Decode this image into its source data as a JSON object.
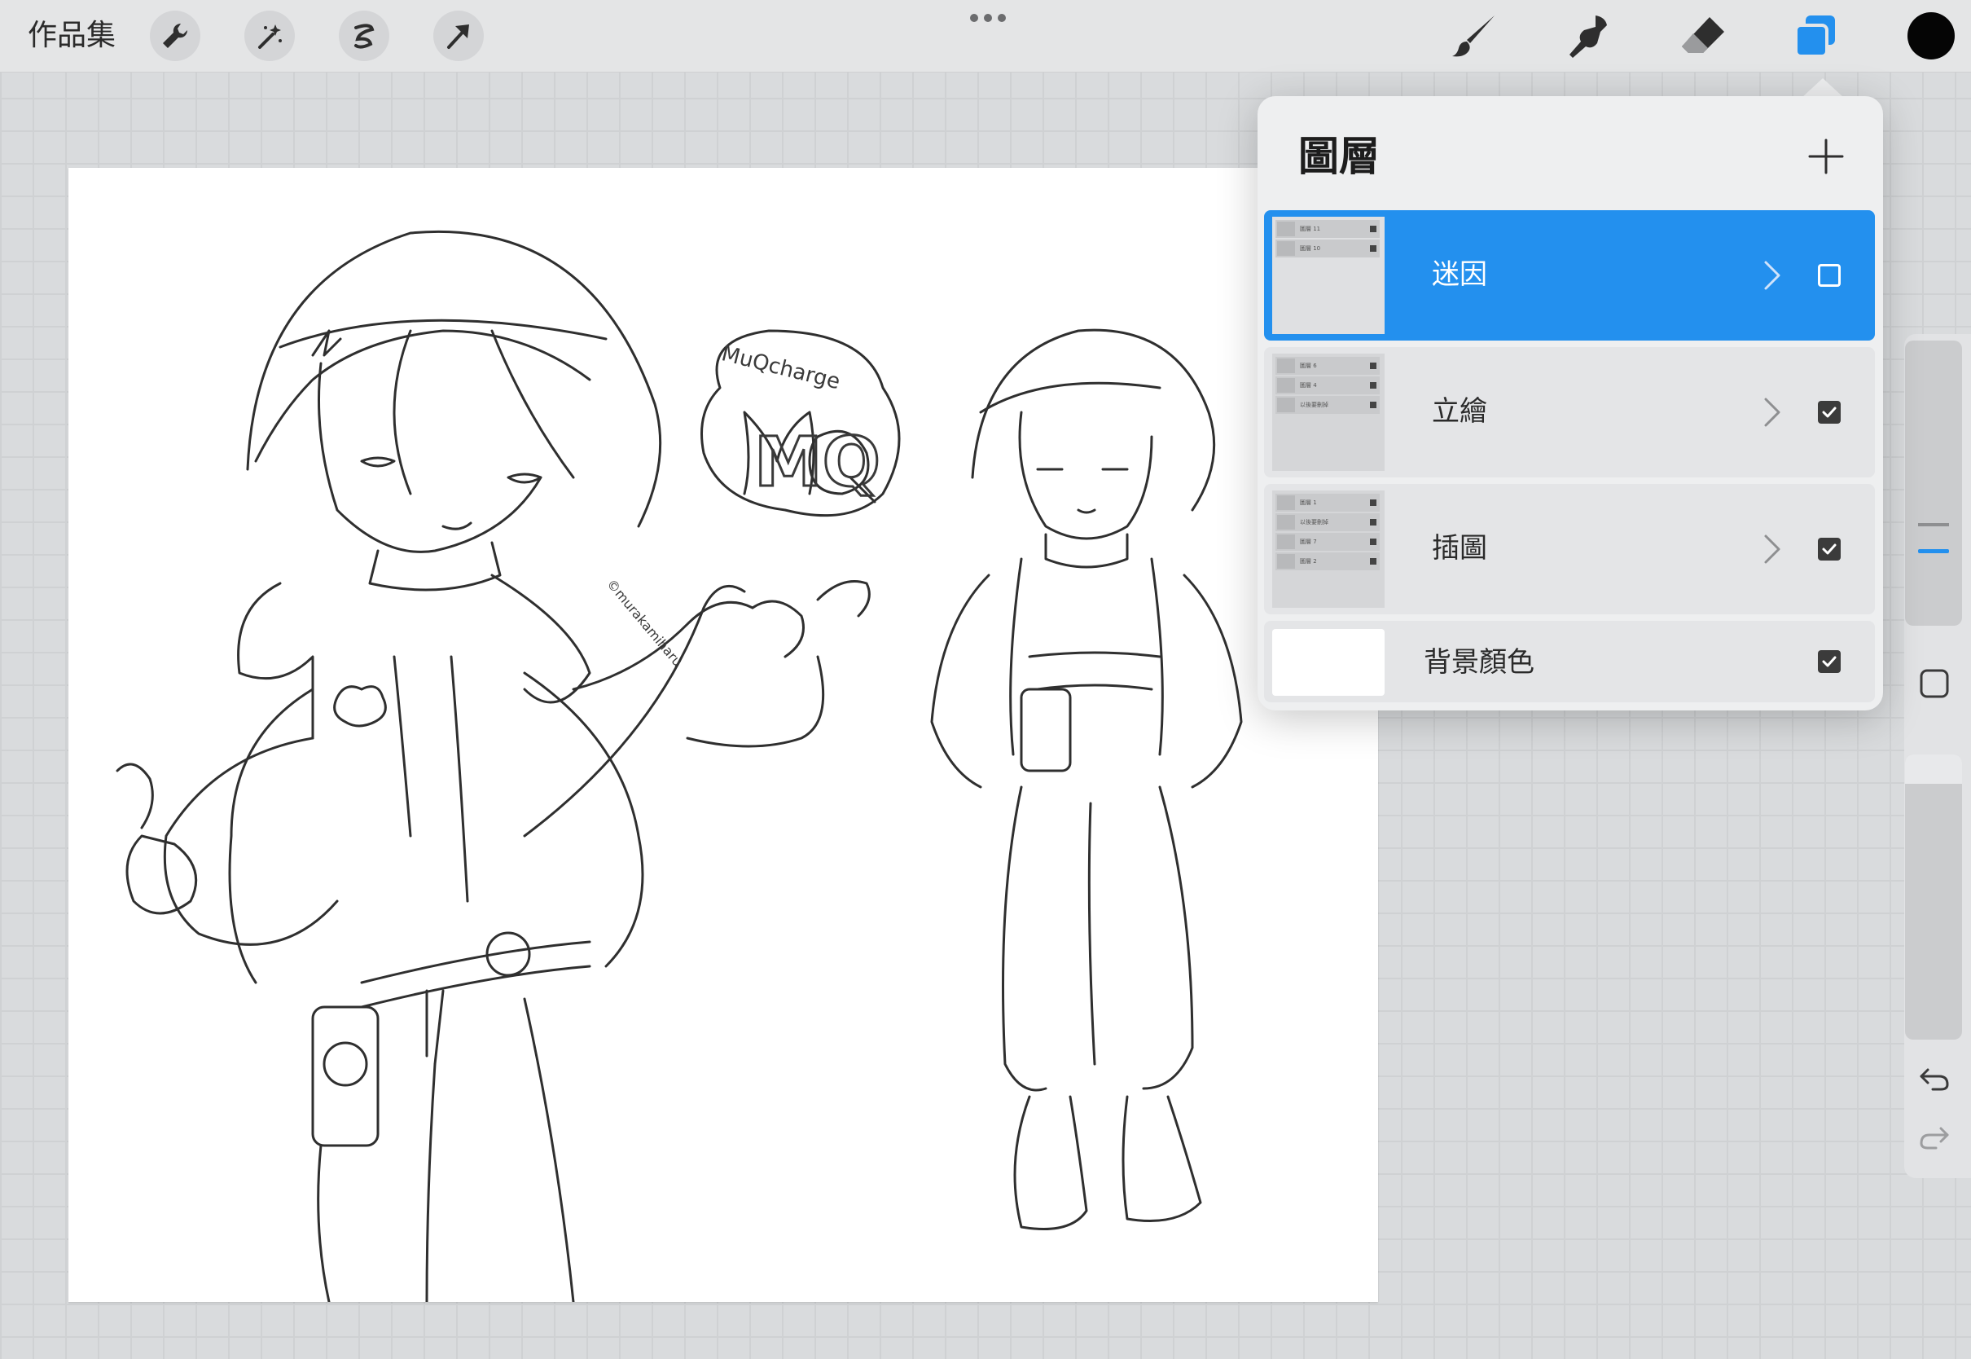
{
  "topbar": {
    "gallery_label": "作品集",
    "tools_left": [
      "wrench-icon",
      "magic-wand-icon",
      "selection-icon",
      "transform-arrow-icon"
    ],
    "tools_right": [
      "brush-icon",
      "smudge-icon",
      "eraser-icon",
      "layers-icon"
    ],
    "current_color": "#050505",
    "accent_color": "#2390ee"
  },
  "artwork": {
    "badge_text": "MuQcharge",
    "badge_logo": "MQ",
    "signature": "©murakamiharu"
  },
  "layers_panel": {
    "title": "圖層",
    "add_label": "+",
    "layers": [
      {
        "name": "迷因",
        "selected": true,
        "visible": false,
        "thumb_rows": [
          "圖層 11",
          "圖層 10"
        ]
      },
      {
        "name": "立繪",
        "selected": false,
        "visible": true,
        "thumb_rows": [
          "圖層 6",
          "圖層 4",
          "以後要刪掉"
        ]
      },
      {
        "name": "插圖",
        "selected": false,
        "visible": true,
        "thumb_rows": [
          "圖層 1",
          "以後要刪掉",
          "圖層 7",
          "圖層 2"
        ]
      }
    ],
    "background": {
      "name": "背景顏色",
      "visible": true,
      "color": "#ffffff"
    }
  },
  "sidebar": {
    "brush_size_level": 0.25,
    "opacity_level": 0.05,
    "buttons": [
      "modify-square-icon",
      "undo-icon",
      "redo-icon"
    ]
  }
}
